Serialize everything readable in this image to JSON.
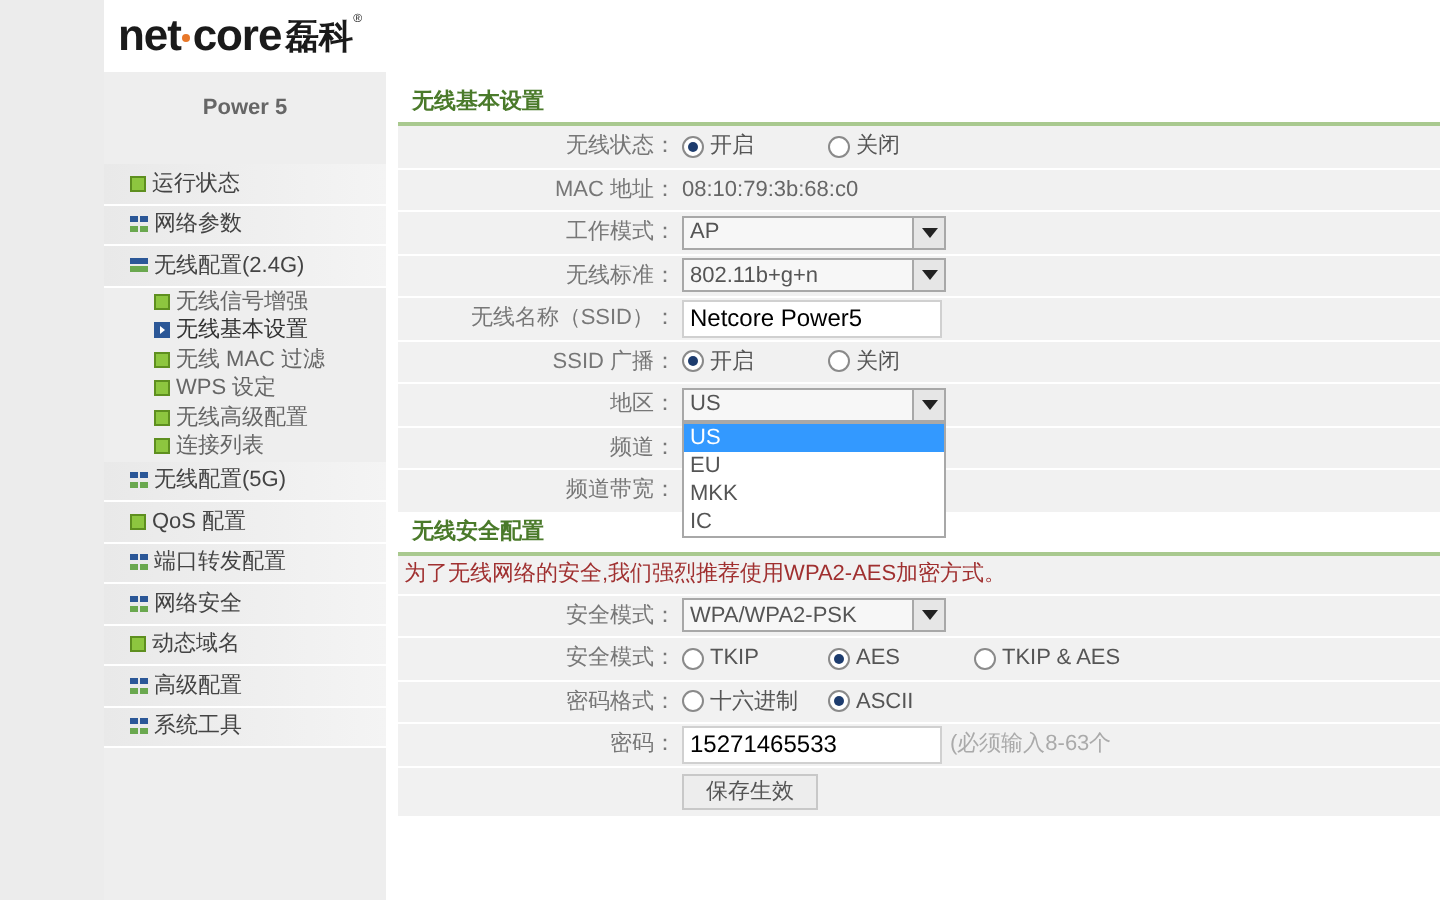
{
  "logo": {
    "left": "net",
    "right": "core",
    "cn": "磊科",
    "mark": "®"
  },
  "sidebar": {
    "title": "Power 5",
    "items": [
      {
        "label": "运行状态",
        "kind": "square",
        "selected": false
      },
      {
        "label": "网络参数",
        "kind": "grid",
        "selected": false
      },
      {
        "label": "无线配置(2.4G)",
        "kind": "minus",
        "selected": false,
        "children": [
          {
            "label": "无线信号增强",
            "selected": false
          },
          {
            "label": "无线基本设置",
            "selected": true
          },
          {
            "label": "无线 MAC 过滤",
            "selected": false
          },
          {
            "label": "WPS 设定",
            "selected": false
          },
          {
            "label": "无线高级配置",
            "selected": false
          },
          {
            "label": "连接列表",
            "selected": false
          }
        ]
      },
      {
        "label": "无线配置(5G)",
        "kind": "grid",
        "selected": false
      },
      {
        "label": "QoS 配置",
        "kind": "square",
        "selected": false
      },
      {
        "label": "端口转发配置",
        "kind": "grid",
        "selected": false
      },
      {
        "label": "网络安全",
        "kind": "grid",
        "selected": false
      },
      {
        "label": "动态域名",
        "kind": "square",
        "selected": false
      },
      {
        "label": "高级配置",
        "kind": "grid",
        "selected": false
      },
      {
        "label": "系统工具",
        "kind": "grid",
        "selected": false
      }
    ]
  },
  "sections": [
    {
      "title": "无线基本设置",
      "rows": [
        {
          "kind": "radio",
          "label": "无线状态：",
          "options": [
            {
              "label": "开启",
              "selected": true
            },
            {
              "label": "关闭",
              "selected": false
            }
          ]
        },
        {
          "kind": "text",
          "label": "MAC 地址：",
          "value": "08:10:79:3b:68:c0"
        },
        {
          "kind": "select",
          "label": "工作模式：",
          "value": "AP"
        },
        {
          "kind": "select",
          "label": "无线标准：",
          "value": "802.11b+g+n"
        },
        {
          "kind": "input",
          "label": "无线名称（SSID）：",
          "value": "Netcore Power5"
        },
        {
          "kind": "radio",
          "label": "SSID 广播：",
          "options": [
            {
              "label": "开启",
              "selected": true
            },
            {
              "label": "关闭",
              "selected": false
            }
          ]
        },
        {
          "kind": "select",
          "label": "地区：",
          "value": "US",
          "open": true,
          "options": [
            {
              "label": "US",
              "selected": true
            },
            {
              "label": "EU",
              "selected": false
            },
            {
              "label": "MKK",
              "selected": false
            },
            {
              "label": "IC",
              "selected": false
            }
          ]
        },
        {
          "kind": "empty",
          "label": "频道："
        },
        {
          "kind": "empty",
          "label": "频道带宽："
        }
      ]
    },
    {
      "title": "无线安全配置",
      "note": "为了无线网络的安全,我们强烈推荐使用WPA2-AES加密方式。",
      "rows": [
        {
          "kind": "select",
          "label": "安全模式：",
          "value": "WPA/WPA2-PSK"
        },
        {
          "kind": "radio",
          "label": "安全模式：",
          "options": [
            {
              "label": "TKIP",
              "selected": false
            },
            {
              "label": "AES",
              "selected": true
            },
            {
              "label": "TKIP & AES",
              "selected": false
            }
          ]
        },
        {
          "kind": "radio",
          "label": "密码格式：",
          "options": [
            {
              "label": "十六进制",
              "selected": false
            },
            {
              "label": "ASCII",
              "selected": true
            }
          ]
        },
        {
          "kind": "input",
          "label": "密码：",
          "value": "15271465533",
          "hint": "(必须输入8-63个"
        }
      ]
    }
  ],
  "save_button": "保存生效"
}
